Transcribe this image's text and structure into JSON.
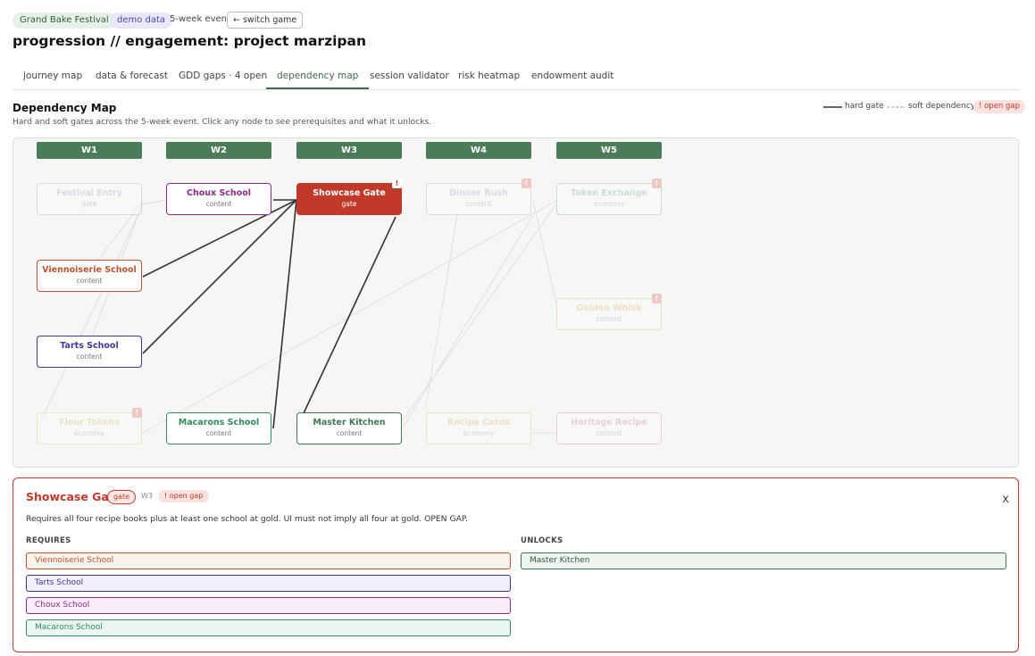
{
  "header": {
    "festival_label": "Grand Bake Festival",
    "demo_label": "demo data",
    "event_label": "5-week event",
    "switch_label": "← switch game",
    "title": "progression // engagement: project marzipan"
  },
  "tabs": [
    {
      "label": "journey map"
    },
    {
      "label": "data & forecast"
    },
    {
      "label": "GDD gaps · 4 open"
    },
    {
      "label": "dependency map",
      "active": true
    },
    {
      "label": "session validator"
    },
    {
      "label": "risk heatmap"
    },
    {
      "label": "endowment audit"
    }
  ],
  "section": {
    "title": "Dependency Map",
    "subtitle": "Hard and soft gates across the 5-week event. Click any node to see prerequisites and what it unlocks."
  },
  "legend": {
    "hard": "hard gate",
    "soft": "soft dependency",
    "gap": "! open gap"
  },
  "weeks": [
    "W1",
    "W2",
    "W3",
    "W4",
    "W5"
  ],
  "nodes": [
    {
      "name": "Festival Entry",
      "type": "gate",
      "faded": true,
      "color": "#7a9cc6"
    },
    {
      "name": "Choux School",
      "type": "content",
      "color": "#8e2a8a"
    },
    {
      "name": "Showcase Gate",
      "type": "gate",
      "selected": true,
      "gap": "!",
      "color": "#c0392b"
    },
    {
      "name": "Dinner Rush",
      "type": "content",
      "faded": true,
      "gap": "!",
      "color": "#7a9cc6"
    },
    {
      "name": "Token Exchange",
      "type": "economy",
      "faded": true,
      "gap": "!",
      "color": "#57a57a"
    },
    {
      "name": "Viennoiserie School",
      "type": "content",
      "color": "#c0522b"
    },
    {
      "name": "Golden Whisk",
      "type": "content",
      "faded": true,
      "gap": "!",
      "color": "#d4a64a"
    },
    {
      "name": "Tarts School",
      "type": "content",
      "color": "#3d3799"
    },
    {
      "name": "Flour Tokens",
      "type": "economy",
      "faded": true,
      "gap": "!",
      "color": "#c8b45a"
    },
    {
      "name": "Macarons School",
      "type": "content",
      "color": "#2f8a5e"
    },
    {
      "name": "Master Kitchen",
      "type": "content",
      "color": "#3d7a52"
    },
    {
      "name": "Recipe Cards",
      "type": "economy",
      "faded": true,
      "color": "#d4a64a"
    },
    {
      "name": "Heritage Recipe",
      "type": "content",
      "faded": true,
      "color": "#c76a8a"
    }
  ],
  "detail": {
    "title": "Showcase Gate",
    "type": "gate",
    "week": "W3",
    "gap": "! open gap",
    "close": "x",
    "description": "Requires all four recipe books plus at least one school at gold. UI must not imply all four at gold. OPEN GAP.",
    "requires_label": "REQUIRES",
    "unlocks_label": "UNLOCKS",
    "requires": [
      {
        "label": "Viennoiserie School",
        "color": "#c0522b",
        "bg": "#fdf3ee"
      },
      {
        "label": "Tarts School",
        "color": "#3d3799",
        "bg": "#f1f0fb"
      },
      {
        "label": "Choux School",
        "color": "#8e2a8a",
        "bg": "#f9eef8"
      },
      {
        "label": "Macarons School",
        "color": "#2f8a5e",
        "bg": "#eaf6ef"
      }
    ],
    "unlocks": [
      {
        "label": "Master Kitchen",
        "color": "#3d7a52",
        "bg": "#edf5ee"
      }
    ]
  },
  "colors": {
    "accent": "#4a7c59",
    "gap": "#c0392b",
    "hard_edge": "#333333",
    "soft_edge": "#cccccc"
  }
}
